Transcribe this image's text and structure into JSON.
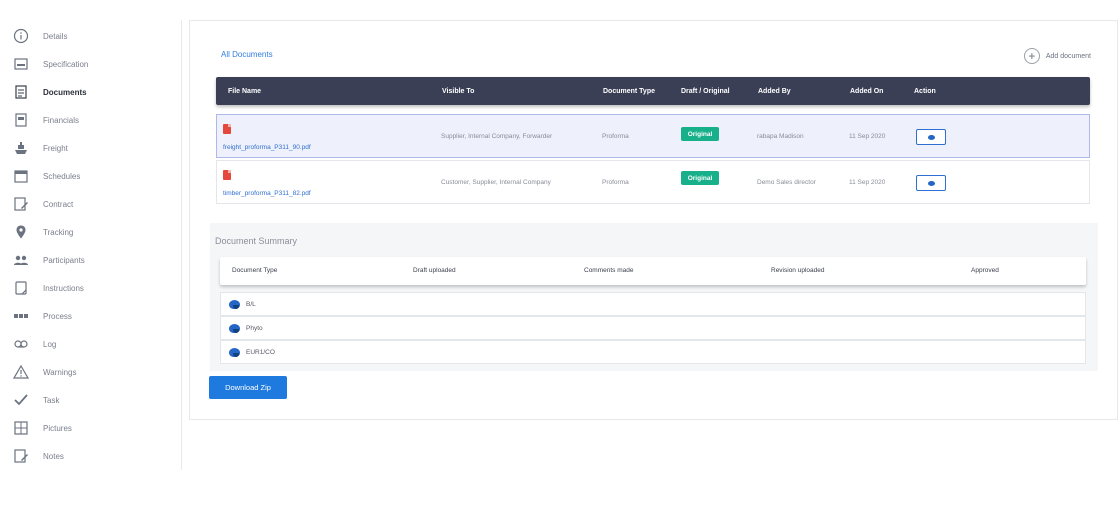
{
  "sidebar": {
    "items": [
      {
        "label": "Details",
        "icon": "info-icon"
      },
      {
        "label": "Specification",
        "icon": "spec-icon"
      },
      {
        "label": "Documents",
        "icon": "documents-icon",
        "active": true
      },
      {
        "label": "Financials",
        "icon": "financials-icon"
      },
      {
        "label": "Freight",
        "icon": "ship-icon"
      },
      {
        "label": "Schedules",
        "icon": "calendar-icon"
      },
      {
        "label": "Contract",
        "icon": "contract-icon"
      },
      {
        "label": "Tracking",
        "icon": "location-pin-icon"
      },
      {
        "label": "Participants",
        "icon": "participants-icon"
      },
      {
        "label": "Instructions",
        "icon": "instructions-icon"
      },
      {
        "label": "Process",
        "icon": "process-icon"
      },
      {
        "label": "Log",
        "icon": "log-icon"
      },
      {
        "label": "Warnings",
        "icon": "warning-icon"
      },
      {
        "label": "Task",
        "icon": "checkmark-icon"
      },
      {
        "label": "Pictures",
        "icon": "pictures-icon"
      },
      {
        "label": "Notes",
        "icon": "notes-icon"
      }
    ]
  },
  "main": {
    "all_documents_link": "All Documents",
    "add_document_label": "Add document",
    "table": {
      "headers": [
        "File Name",
        "Visible To",
        "Document Type",
        "Draft / Original",
        "Added By",
        "Added On",
        "Action"
      ],
      "rows": [
        {
          "file_name": "freight_proforma_P311_90.pdf",
          "visible_to": "Supplier, Internal Company, Forwarder",
          "document_type": "Proforma",
          "status": "Original",
          "added_by": "rabapa Madison",
          "added_on": "11 Sep 2020",
          "selected": true
        },
        {
          "file_name": "timber_proforma_P311_82.pdf",
          "visible_to": "Customer, Supplier, Internal Company",
          "document_type": "Proforma",
          "status": "Original",
          "added_by": "Demo Sales director",
          "added_on": "11 Sep 2020",
          "selected": false
        }
      ]
    },
    "summary": {
      "title": "Document Summary",
      "headers": [
        "Document Type",
        "Draft uploaded",
        "Comments made",
        "Revision uploaded",
        "Approved"
      ],
      "rows": [
        "B/L",
        "Phyto",
        "EUR1/CO"
      ]
    },
    "download_label": "Download Zip"
  },
  "colors": {
    "accent": "#1f7ae0",
    "header_bg": "#3a3f56",
    "badge": "#17b08a",
    "pdf": "#e4483c"
  }
}
